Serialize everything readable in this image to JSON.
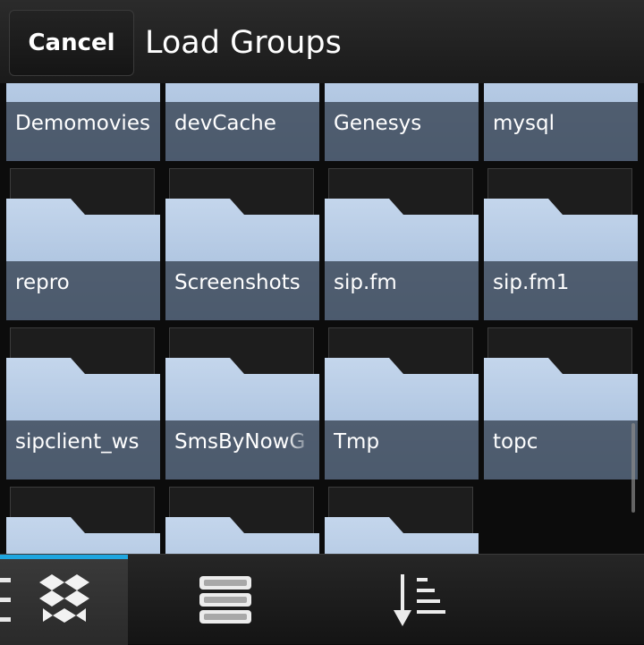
{
  "header": {
    "cancel_label": "Cancel",
    "title": "Load Groups"
  },
  "folders": [
    {
      "name": "Demomovies"
    },
    {
      "name": "devCache"
    },
    {
      "name": "Genesys"
    },
    {
      "name": "mysql"
    },
    {
      "name": "repro"
    },
    {
      "name": "Screenshots"
    },
    {
      "name": "sip.fm"
    },
    {
      "name": "sip.fm1"
    },
    {
      "name": "sipclient_ws"
    },
    {
      "name": "SmsByNowG"
    },
    {
      "name": "Tmp"
    },
    {
      "name": "topc"
    },
    {
      "name": ""
    },
    {
      "name": ""
    },
    {
      "name": ""
    }
  ],
  "bottom_bar": {
    "icons": [
      "dropbox-icon",
      "list-view-icon",
      "sort-icon"
    ],
    "accent_color": "#1fa6e0"
  },
  "colors": {
    "folder_light": "#c4d6ec",
    "folder_dark": "#9fb8d8",
    "label_band": "#344050"
  }
}
